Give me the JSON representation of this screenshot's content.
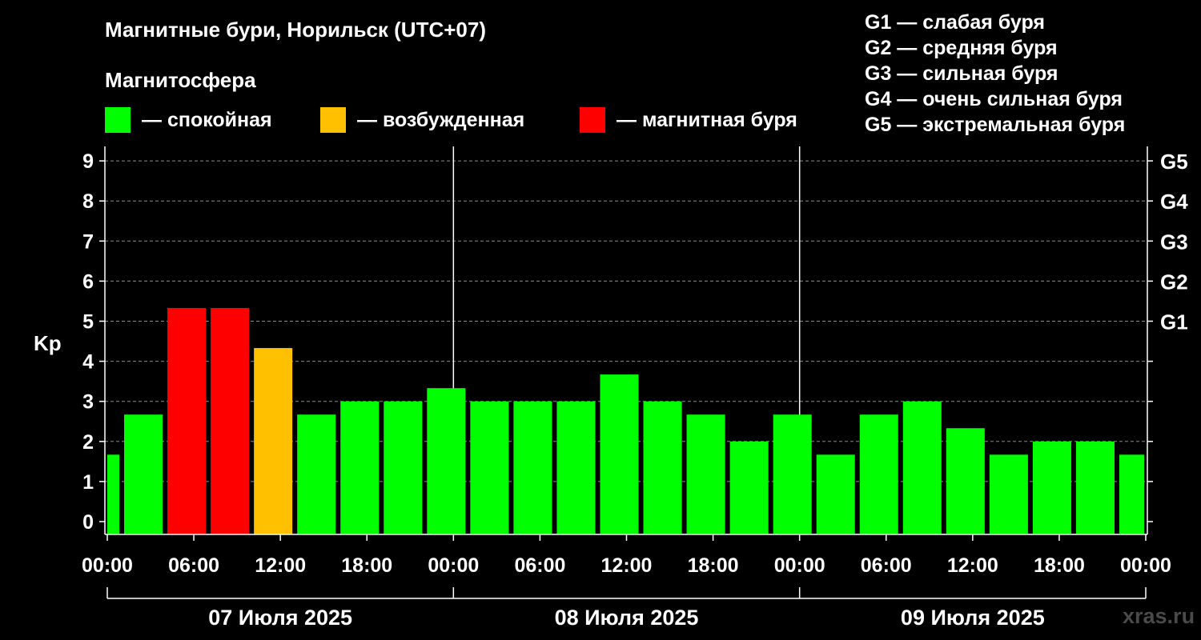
{
  "title": "Магнитные бури, Норильск (UTC+07)",
  "subtitle": "Магнитосфера",
  "legend": [
    {
      "label": "— спокойная",
      "color": "#00ff00"
    },
    {
      "label": "— возбужденная",
      "color": "#ffc000"
    },
    {
      "label": "— магнитная буря",
      "color": "#ff0000"
    }
  ],
  "g_scale": [
    "G1 — слабая буря",
    "G2 — средняя буря",
    "G3 — сильная буря",
    "G4 — очень сильная буря",
    "G5 — экстремальная буря"
  ],
  "watermark": "xras.ru",
  "colors": {
    "quiet": "#00ff00",
    "active": "#ffc000",
    "storm": "#ff0000",
    "background": "#000000",
    "axis": "#ffffff",
    "grid": "#8c8c8c"
  },
  "chart_data": {
    "type": "bar",
    "ylabel": "Kp",
    "ylim": [
      0,
      9
    ],
    "y_ticks": [
      "0",
      "1",
      "2",
      "3",
      "4",
      "5",
      "6",
      "7",
      "8",
      "9"
    ],
    "right_ticks": [
      {
        "value": 5,
        "label": "G1"
      },
      {
        "value": 6,
        "label": "G2"
      },
      {
        "value": 7,
        "label": "G3"
      },
      {
        "value": 8,
        "label": "G4"
      },
      {
        "value": 9,
        "label": "G5"
      }
    ],
    "x_tick_labels": [
      "00:00",
      "06:00",
      "12:00",
      "18:00",
      "00:00",
      "06:00",
      "12:00",
      "18:00",
      "00:00",
      "06:00",
      "12:00",
      "18:00",
      "00:00"
    ],
    "day_labels": [
      "07 Июля 2025",
      "08 Июля 2025",
      "09 Июля 2025"
    ],
    "grid": "horizontal dashed",
    "intervals": [
      "00–03",
      "03–06",
      "06–09",
      "09–12",
      "12–15",
      "15–18",
      "18–21",
      "21–24",
      "00–03",
      "03–06",
      "06–09",
      "09–12",
      "12–15",
      "15–18",
      "18–21",
      "21–24",
      "00–03",
      "03–06",
      "06–09",
      "09–12",
      "12–15",
      "15–18",
      "18–21",
      "21–24"
    ],
    "values": [
      1.67,
      2.67,
      5.33,
      5.33,
      4.33,
      2.67,
      3.0,
      3.0,
      3.33,
      3.0,
      3.0,
      3.0,
      3.67,
      3.0,
      2.67,
      2.0,
      2.67,
      1.67,
      2.67,
      3.0,
      2.33,
      1.67,
      2.0,
      2.0,
      1.67
    ],
    "levels": [
      "quiet",
      "quiet",
      "storm",
      "storm",
      "active",
      "quiet",
      "quiet",
      "quiet",
      "quiet",
      "quiet",
      "quiet",
      "quiet",
      "quiet",
      "quiet",
      "quiet",
      "quiet",
      "quiet",
      "quiet",
      "quiet",
      "quiet",
      "quiet",
      "quiet",
      "quiet",
      "quiet",
      "quiet"
    ]
  }
}
